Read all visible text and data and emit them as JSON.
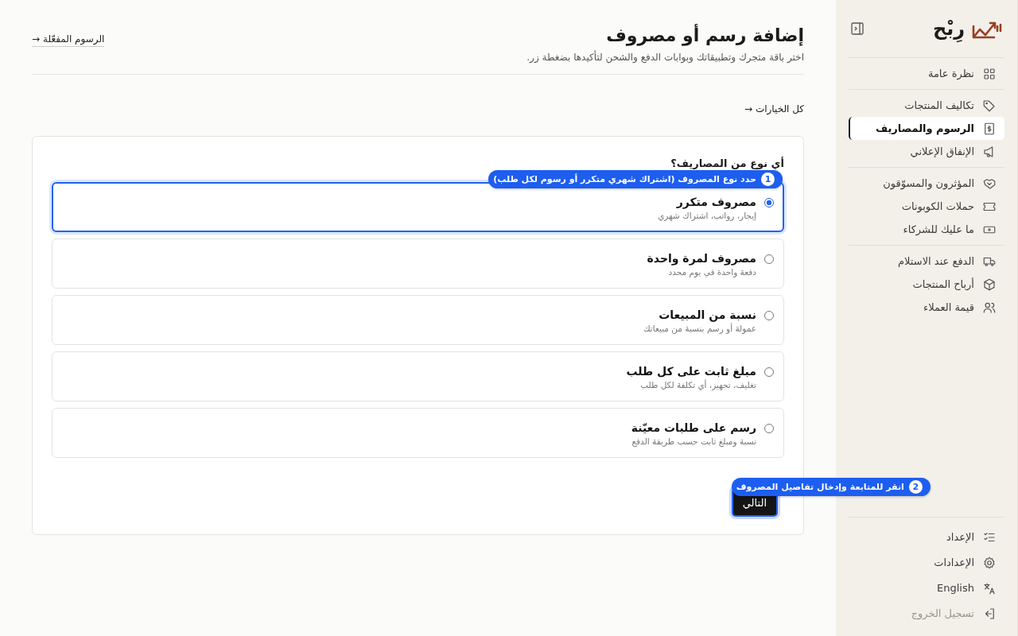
{
  "sidebar": {
    "logo": "رِبْح",
    "groups": [
      [
        {
          "label": "نظرة عامة",
          "selected": false
        }
      ],
      [
        {
          "label": "تكاليف المنتجات",
          "selected": false
        },
        {
          "label": "الرسوم والمصاريف",
          "selected": true
        },
        {
          "label": "الإنفاق الإعلاني",
          "selected": false
        }
      ],
      [
        {
          "label": "المؤثرون والمسوّقون",
          "selected": false
        },
        {
          "label": "حملات الكوبونات",
          "selected": false
        },
        {
          "label": "ما عليك للشركاء",
          "selected": false
        }
      ],
      [
        {
          "label": "الدفع عند الاستلام",
          "selected": false
        },
        {
          "label": "أرباح المنتجات",
          "selected": false
        },
        {
          "label": "قيمة العملاء",
          "selected": false
        }
      ]
    ],
    "footer": [
      {
        "label": "الإعداد",
        "disabled": false
      },
      {
        "label": "الإعدادات",
        "disabled": false
      },
      {
        "label": "English",
        "disabled": false
      },
      {
        "label": "تسجيل الخروج",
        "disabled": true
      }
    ]
  },
  "header": {
    "title": "إضافة رسم أو مصروف",
    "subtitle": "اختر باقة متجرك وتطبيقاتك وبوابات الدفع والشحن لتأكيدها بضغطة زر.",
    "back_link": {
      "arrow": "→",
      "label": "الرسوم المفعّلة"
    }
  },
  "all_options_link": {
    "arrow": "→",
    "label": "كل الخيارات"
  },
  "form": {
    "question": "أي نوع من المصاريف؟",
    "options": [
      {
        "title": "مصروف متكرر",
        "description": "إيجار، رواتب، اشتراك شهري",
        "selected": true
      },
      {
        "title": "مصروف لمرة واحدة",
        "description": "دفعة واحدة في يوم محدد",
        "selected": false
      },
      {
        "title": "نسبة من المبيعات",
        "description": "عمولة أو رسم بنسبة من مبيعاتك",
        "selected": false
      },
      {
        "title": "مبلغ ثابت على كل طلب",
        "description": "تغليف، تجهيز، أي تكلفة لكل طلب",
        "selected": false
      },
      {
        "title": "رسم على طلبات معيّنة",
        "description": "نسبة ومبلغ ثابت حسب طريقة الدفع",
        "selected": false
      }
    ],
    "next_button": "التالي"
  },
  "tooltips": [
    {
      "number": "1",
      "text": "حدد نوع المصروف (اشتراك شهري متكرر أو رسوم لكل طلب)"
    },
    {
      "number": "2",
      "text": "انقر للمتابعة وإدخال تفاصيل المصروف"
    }
  ]
}
